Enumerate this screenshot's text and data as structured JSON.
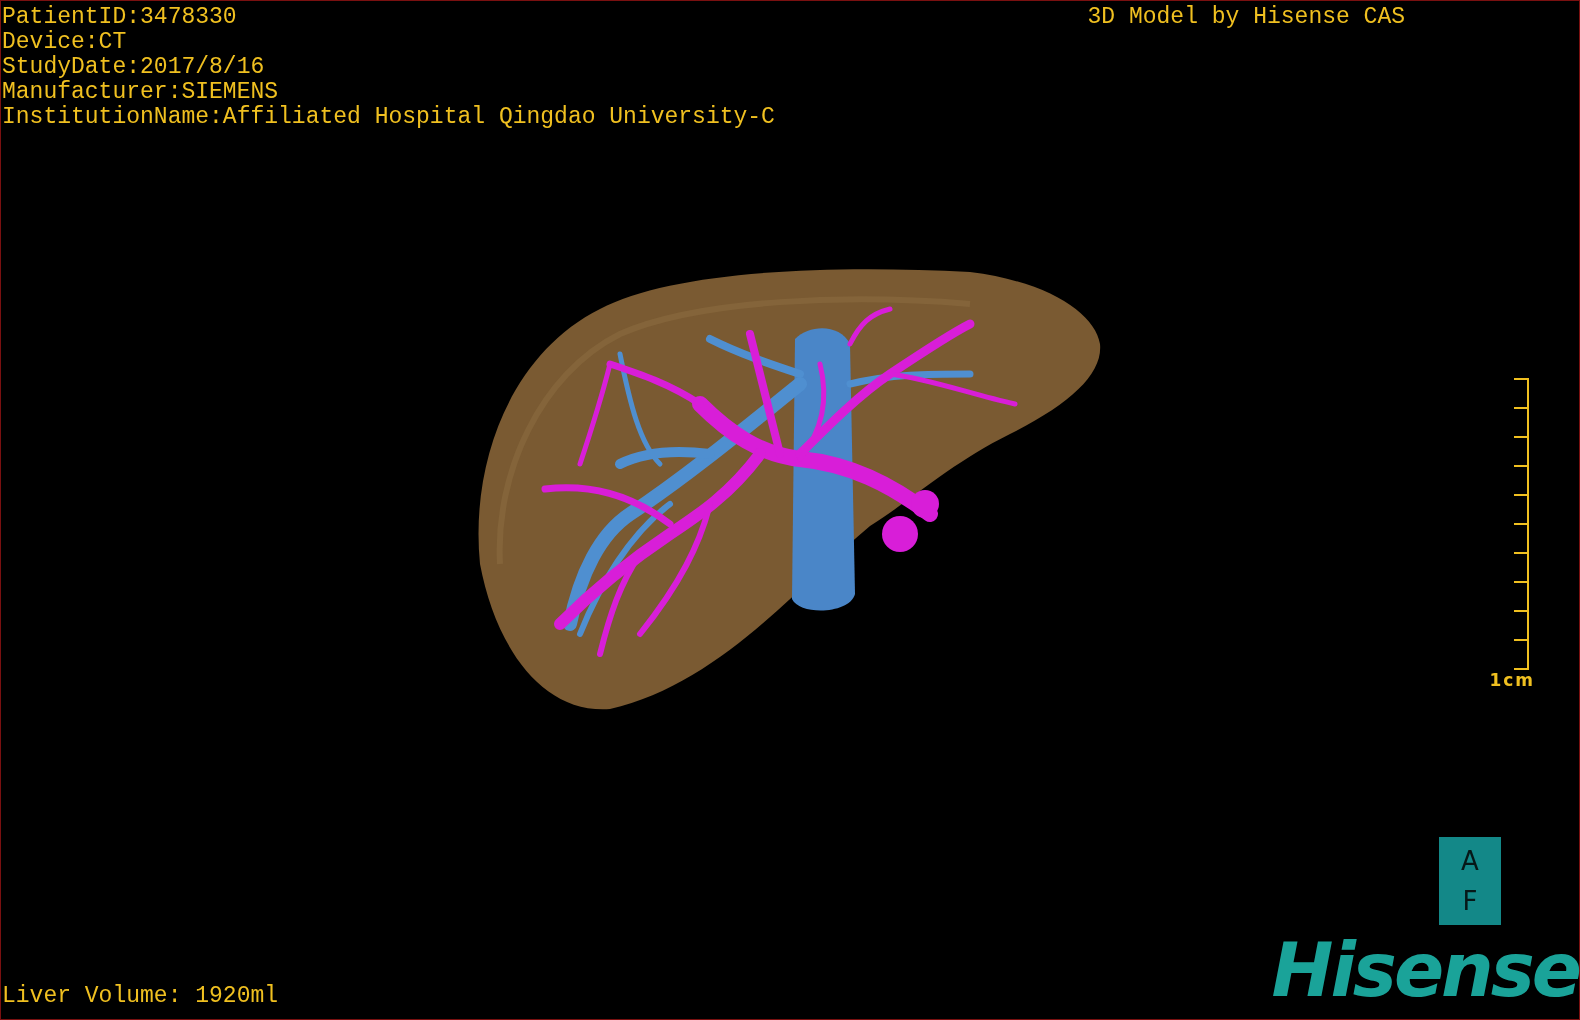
{
  "study_info": [
    "PatientID:3478330",
    "Device:CT",
    "StudyDate:2017/8/16",
    "Manufacturer:SIEMENS",
    "InstitutionName:Affiliated Hospital Qingdao University-C"
  ],
  "title": "3D Model by Hisense CAS",
  "scale_bar": {
    "label": "1cm"
  },
  "orientation_cube": {
    "top": "A",
    "bottom": "F"
  },
  "measurement": "Liver Volume: 1920ml",
  "logo": "Hisense"
}
